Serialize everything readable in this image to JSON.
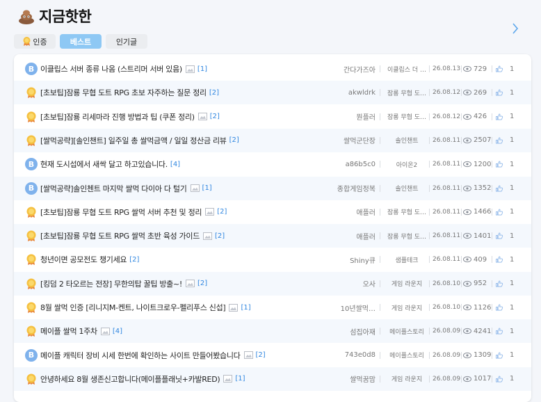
{
  "header": {
    "title": "지금핫한",
    "logo_icon": "poop-mascot-icon",
    "next_icon": "chevron-right-icon"
  },
  "tabs": [
    {
      "label": "인증",
      "icon": "medal-icon",
      "active": false
    },
    {
      "label": "베스트",
      "active": true
    },
    {
      "label": "인기글",
      "active": false
    }
  ],
  "colors": {
    "accent": "#8ec8f4",
    "count": "#2f86e0",
    "badge_b": "#7fb2ec",
    "medal": "#f2b13a"
  },
  "posts": [
    {
      "badge": "B",
      "title": "이클립스 서버 종류 나옴 (스트리머 서버 있음)",
      "image": true,
      "count": "[1]",
      "author": "간다가즈아",
      "category": "이클립스 더 …",
      "date": "26.08.13",
      "views": "729",
      "likes": "1"
    },
    {
      "badge": "medal",
      "title": "[초보팁]잠룡 무협 도트 RPG 초보 자주하는 질문 정리",
      "image": false,
      "count": "[2]",
      "author": "akwldrk",
      "category": "잠룡 무협 도…",
      "date": "26.08.12",
      "views": "269",
      "likes": "1"
    },
    {
      "badge": "medal",
      "title": "[초보팁]잠룡 리세마라 진행 방법과 팁 (쿠폰 정리)",
      "image": true,
      "count": "[2]",
      "author": "뭔플러",
      "category": "잠룡 무협 도…",
      "date": "26.08.12",
      "views": "426",
      "likes": "1"
    },
    {
      "badge": "medal",
      "title": "[쌀먹공략][솔인챈트] 일주일 총 쌀먹금액 / 일일 정산금 리뷰",
      "image": false,
      "count": "[2]",
      "author": "쌀먹군단장",
      "category": "솔인챈트",
      "date": "26.08.11",
      "views": "2507",
      "likes": "1"
    },
    {
      "badge": "B",
      "title": "현재 도시섭에서 새싹 달고 하고있습니다.",
      "image": false,
      "count": "[4]",
      "author": "a86b5c0",
      "category": "아이온2",
      "date": "26.08.11",
      "views": "1200",
      "likes": "1"
    },
    {
      "badge": "B",
      "title": "[쌀먹공략]솔인첸트 마지막 쌀먹 다이아 다 털기",
      "image": true,
      "count": "[1]",
      "author": "종합게임정복",
      "category": "솔인챈트",
      "date": "26.08.11",
      "views": "1352",
      "likes": "1"
    },
    {
      "badge": "medal",
      "title": "[초보팁]잠룡 무협 도트 RPG 쌀먹 서버 추천 및 정리",
      "image": true,
      "count": "[2]",
      "author": "애플러",
      "category": "잠룡 무협 도…",
      "date": "26.08.11",
      "views": "1466",
      "likes": "1"
    },
    {
      "badge": "medal",
      "title": "[초보팁]잠룡 무협 도트 RPG 쌀먹 초반 육성 가이드",
      "image": true,
      "count": "[2]",
      "author": "애플러",
      "category": "잠룡 무협 도…",
      "date": "26.08.11",
      "views": "1401",
      "likes": "1"
    },
    {
      "badge": "medal",
      "title": "청년이면 공모전도 챙기세요",
      "image": false,
      "count": "[2]",
      "author": "Shiny큐",
      "category": "샘플테크",
      "date": "26.08.11",
      "views": "409",
      "likes": "1"
    },
    {
      "badge": "medal",
      "title": "[킹덤 2 타오르는 전장] 무한의탑 꿀팁 방출~!",
      "image": true,
      "count": "[2]",
      "author": "오사",
      "category": "게임 라운지",
      "date": "26.08.10",
      "views": "952",
      "likes": "1"
    },
    {
      "badge": "medal",
      "title": "8월 쌀먹 인증 [리니지M-켄트, 나이트크로우-펠리푸스 신섭]",
      "image": true,
      "count": "[1]",
      "author": "10년쌀먹…",
      "category": "게임 라운지",
      "date": "26.08.10",
      "views": "1126",
      "likes": "1"
    },
    {
      "badge": "medal",
      "title": "메이플 쌀먹 1주차",
      "image": true,
      "count": "[4]",
      "author": "섬집아재",
      "category": "메이플스토리",
      "date": "26.08.09",
      "views": "4241",
      "likes": "1"
    },
    {
      "badge": "B",
      "title": "메이플 캐릭터 장비 시세 한번에 확인하는 사이트 만들어봤습니다",
      "image": true,
      "count": "[2]",
      "author": "743e0d8",
      "category": "메이플스토리",
      "date": "26.08.09",
      "views": "1309",
      "likes": "1"
    },
    {
      "badge": "medal",
      "title": "안녕하세요 8월 생존신고합니다(메이플플래닛+카발RED)",
      "image": true,
      "count": "[1]",
      "author": "쌀먹꿈맘",
      "category": "게임 라운지",
      "date": "26.08.09",
      "views": "1017",
      "likes": "1"
    }
  ]
}
